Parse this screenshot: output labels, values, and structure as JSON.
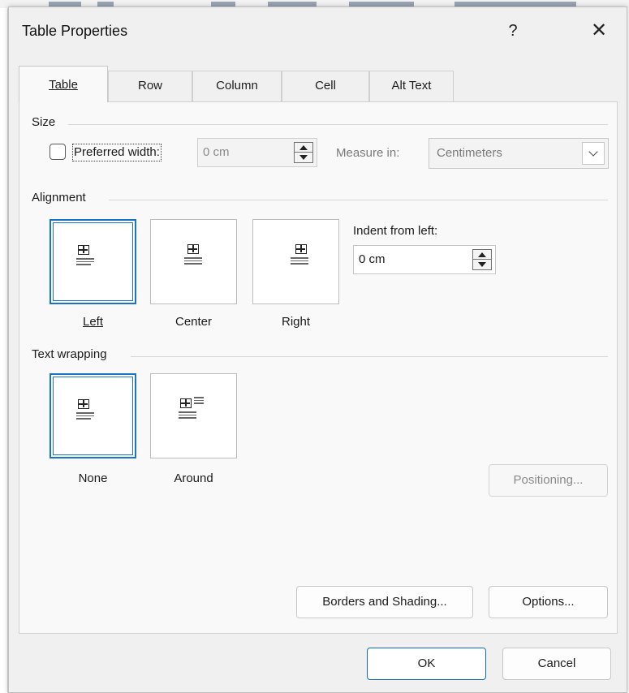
{
  "dialog": {
    "title": "Table Properties",
    "help_label": "?",
    "close_label": "✕"
  },
  "tabs": [
    {
      "label": "Table",
      "active": true
    },
    {
      "label": "Row"
    },
    {
      "label": "Column"
    },
    {
      "label": "Cell"
    },
    {
      "label": "Alt Text"
    }
  ],
  "size": {
    "section_label": "Size",
    "preferred_width_label": "Preferred width:",
    "preferred_width_checked": false,
    "width_value": "0 cm",
    "measure_in_label": "Measure in:",
    "measure_in_value": "Centimeters"
  },
  "alignment": {
    "section_label": "Alignment",
    "options": [
      {
        "label": "Left",
        "selected": true
      },
      {
        "label": "Center",
        "selected": false
      },
      {
        "label": "Right",
        "selected": false
      }
    ],
    "indent_label": "Indent from left:",
    "indent_value": "0 cm"
  },
  "text_wrapping": {
    "section_label": "Text wrapping",
    "options": [
      {
        "label": "None",
        "selected": true
      },
      {
        "label": "Around",
        "selected": false
      }
    ],
    "positioning_label": "Positioning..."
  },
  "buttons": {
    "borders_label": "Borders and Shading...",
    "options_label": "Options...",
    "ok_label": "OK",
    "cancel_label": "Cancel"
  },
  "colors": {
    "accent": "#1a73c4",
    "dialog_bg": "#f0f0f0",
    "panel_bg": "#f9f9f9"
  }
}
